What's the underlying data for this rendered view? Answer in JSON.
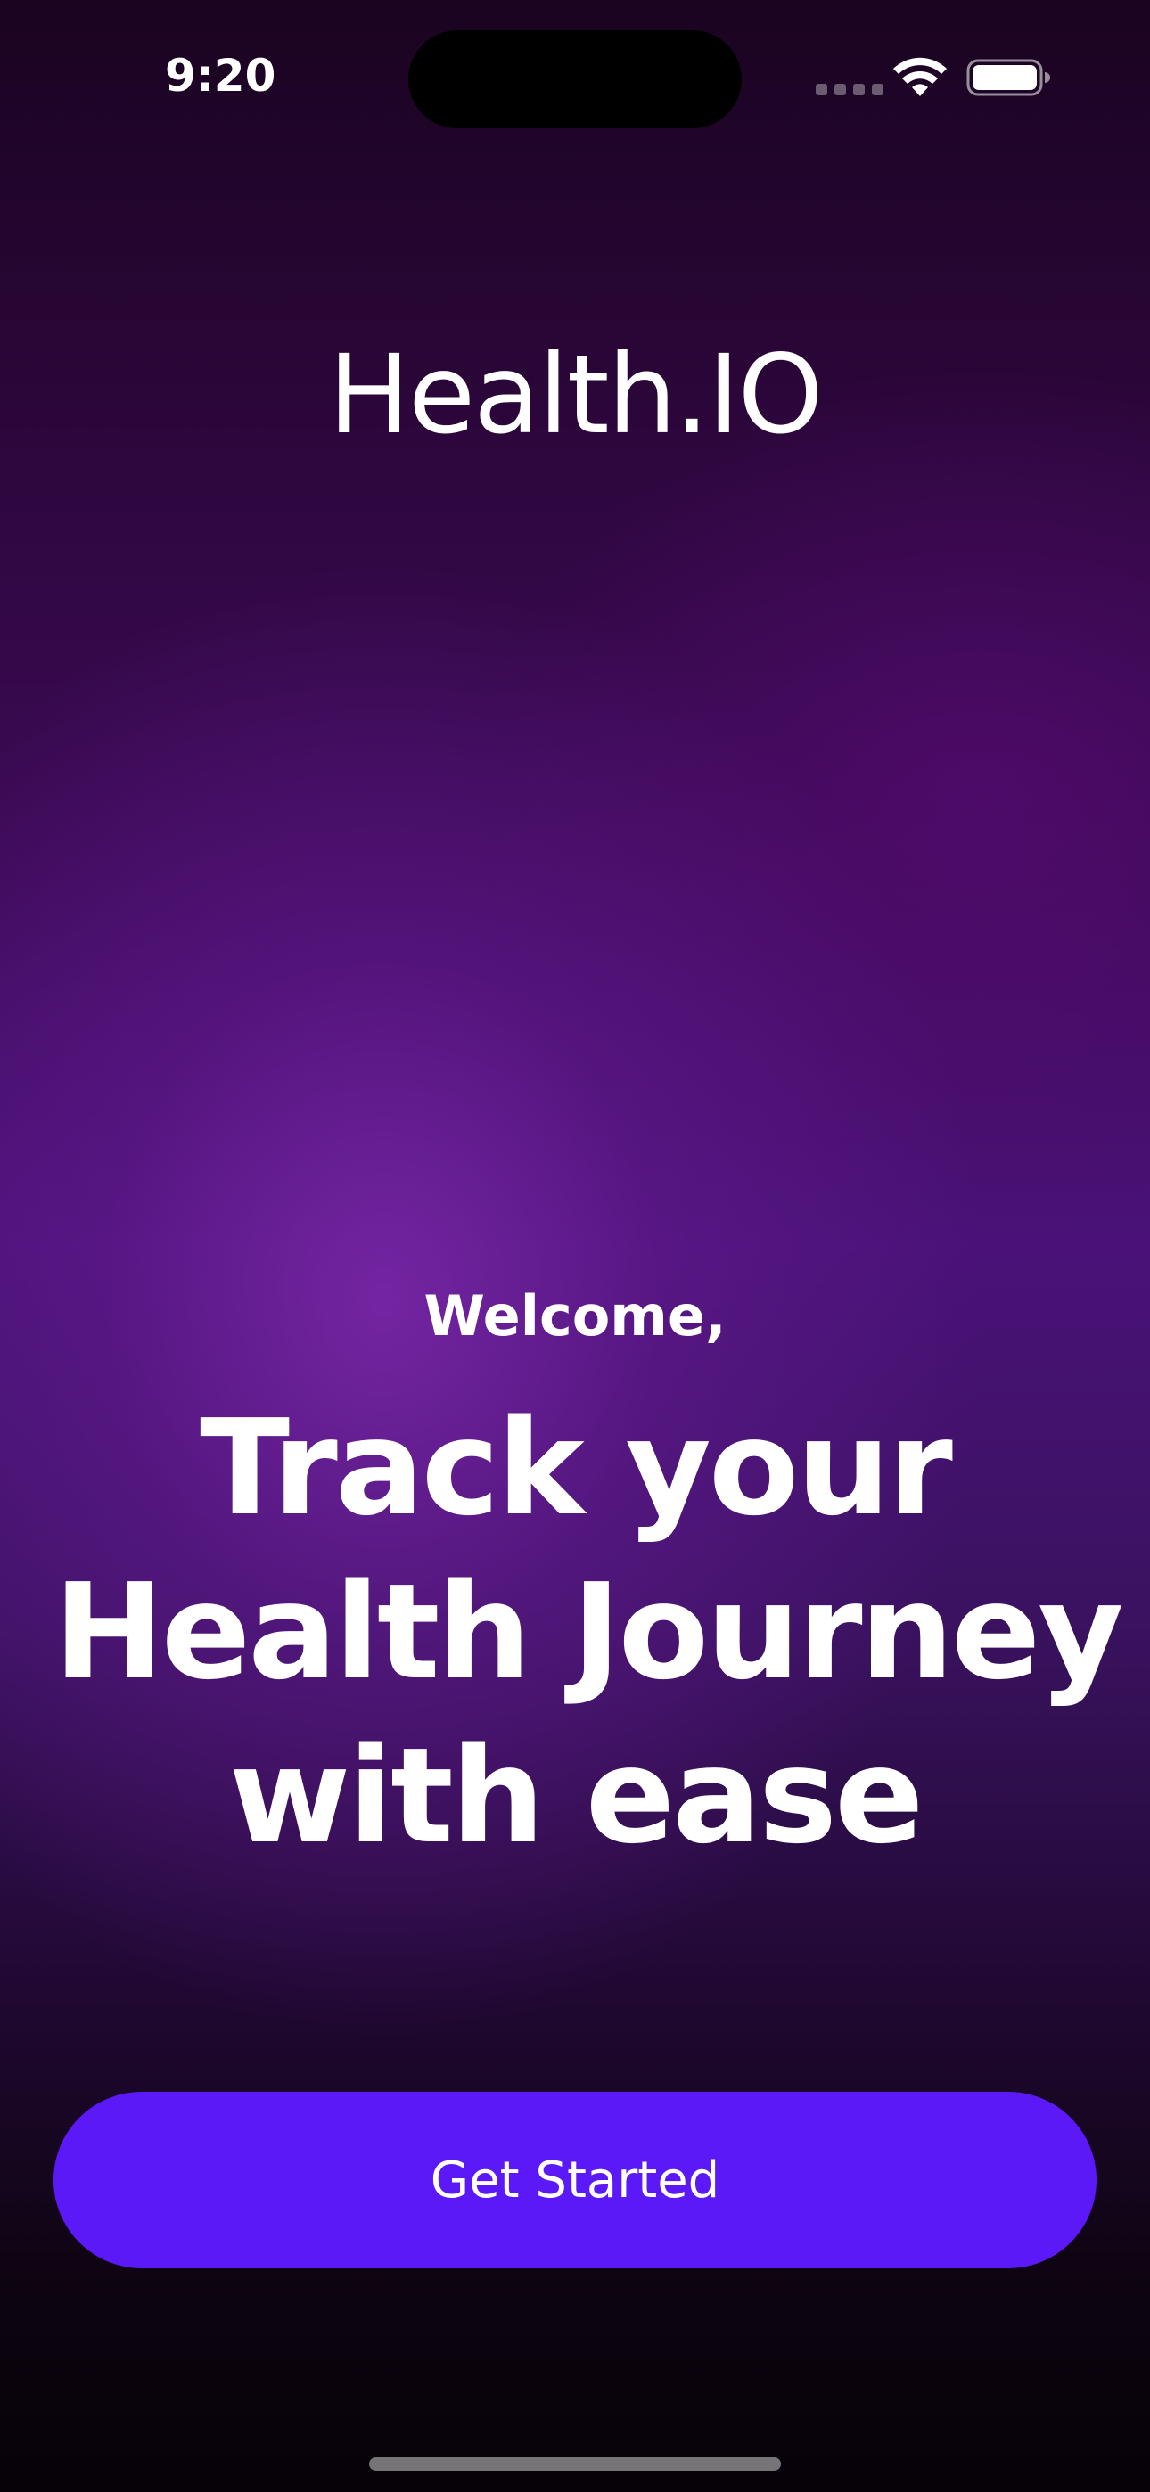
{
  "status_bar": {
    "time": "9:20",
    "icons": [
      "signal-dots-icon",
      "wifi-icon",
      "battery-icon"
    ]
  },
  "brand": {
    "name": "Health.IO"
  },
  "welcome": {
    "greeting": "Welcome,",
    "headline_lines": [
      "Track your",
      "Health Journey",
      "with ease"
    ]
  },
  "cta": {
    "label": "Get Started"
  },
  "colors": {
    "accent": "#5b19f7",
    "background_top": "#1a0420",
    "background_mid": "#4a1278",
    "background_bottom": "#060208",
    "text": "#ffffff"
  }
}
